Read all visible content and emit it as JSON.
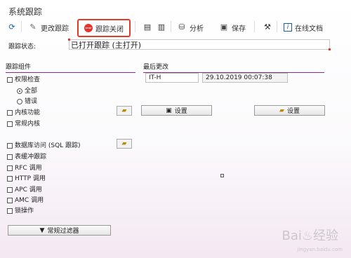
{
  "window": {
    "title": "系统跟踪"
  },
  "toolbar": {
    "items": [
      {
        "label": "",
        "icon": "refresh-icon"
      },
      {
        "label": "更改跟踪",
        "icon": "wand-icon"
      },
      {
        "label": "跟踪关闭",
        "icon": "stop-icon"
      },
      {
        "label": "",
        "icon": "list-export-icon"
      },
      {
        "label": "",
        "icon": "list-icon"
      },
      {
        "label": "分析",
        "icon": "analyze-icon"
      },
      {
        "label": "保存",
        "icon": "save-icon"
      },
      {
        "label": "",
        "icon": "tools-icon"
      },
      {
        "label": "在线文档",
        "icon": "info-icon"
      }
    ],
    "stop_badge": "STOP"
  },
  "status": {
    "label": "跟踪状态:",
    "value": "已打开跟踪 (主打开)"
  },
  "components": {
    "title": "跟踪组件",
    "items": [
      {
        "label": "权限检查"
      },
      {
        "label": "全部",
        "radio": true,
        "selected": true
      },
      {
        "label": "错误",
        "radio": true,
        "selected": false
      },
      {
        "label": "内核功能"
      },
      {
        "label": "常规内核"
      },
      {
        "label": "数据库访问 (SQL 跟踪)"
      },
      {
        "label": "表缓冲跟踪"
      },
      {
        "label": "RFC 调用"
      },
      {
        "label": "HTTP 调用"
      },
      {
        "label": "APC 调用"
      },
      {
        "label": "AMC 调用"
      },
      {
        "label": "锁操作"
      }
    ],
    "filter_button": "常规过滤器"
  },
  "last_change": {
    "title": "最后更改",
    "user": "IT-H",
    "datetime": "29.10.2019 00:07:38"
  },
  "buttons": {
    "settings1": "设置",
    "settings2": "设置"
  },
  "watermark": {
    "text": "Bai♨经验",
    "sub": "jingyan.baidu.com"
  },
  "colors": {
    "highlight": "#e23b2e",
    "group_line": "#8b2a8a"
  }
}
